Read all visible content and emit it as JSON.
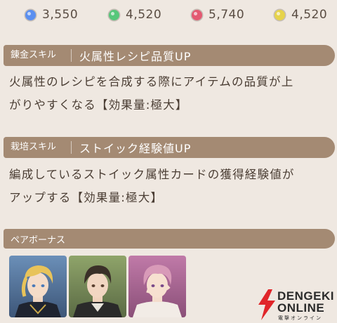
{
  "currencies": [
    {
      "icon": "blue-gem-icon",
      "color": "#5b8ff0",
      "value": "3,550"
    },
    {
      "icon": "green-gem-icon",
      "color": "#56c77a",
      "value": "4,520"
    },
    {
      "icon": "red-gem-icon",
      "color": "#e35a72",
      "value": "5,740"
    },
    {
      "icon": "yellow-gem-icon",
      "color": "#e6d34a",
      "value": "4,520"
    }
  ],
  "skills": [
    {
      "type": "錬金スキル",
      "name": "火属性レシピ品質UP",
      "description_lines": [
        "火属性のレシピを合成する際にアイテムの品質が上",
        "がりやすくなる【効果量:極大】"
      ]
    },
    {
      "type": "栽培スキル",
      "name": "ストイック経験値UP",
      "description_lines": [
        "編成しているストイック属性カードの獲得経験値が",
        "アップする【効果量:極大】"
      ]
    }
  ],
  "pair_bonus": {
    "label": "ペアボーナス",
    "cards": [
      {
        "name": "character-card-blonde"
      },
      {
        "name": "character-card-dark-hair"
      },
      {
        "name": "character-card-pink-hair"
      }
    ]
  },
  "watermark": {
    "line1": "DENGEKI",
    "line2": "ONLINE",
    "line3": "電撃オンライン"
  },
  "colors": {
    "header_bg": "#a48a73",
    "page_bg": "#efe8e1",
    "text": "#4a3d33"
  }
}
